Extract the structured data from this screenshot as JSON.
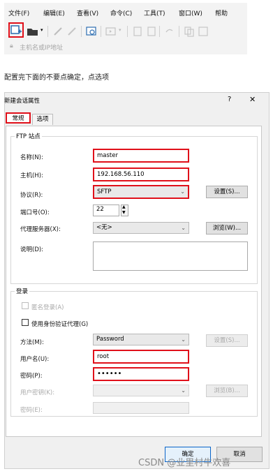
{
  "menu": [
    "文件(F)",
    "编辑(E)",
    "查看(V)",
    "命令(C)",
    "工具(T)",
    "窗口(W)",
    "帮助"
  ],
  "toolbar": {
    "icons": [
      "new-session-icon",
      "open-folder-icon",
      "dropdown-icon",
      "connect-icon",
      "disconnect-icon",
      "terminal-icon",
      "transfer-icon",
      "copy-icon",
      "paste-icon",
      "find-icon",
      "clone-icon",
      "tile-icon"
    ]
  },
  "address_placeholder": "主机名或IP地址",
  "caption": "配置完下面的不要点确定，点选项",
  "dialog": {
    "title": "新建会话属性",
    "help": "?",
    "close": "✕",
    "tabs": [
      "常规",
      "选项"
    ],
    "ftp_group": "FTP 站点",
    "name_label": "名称(N):",
    "name_value": "master",
    "host_label": "主机(H):",
    "host_value": "192.168.56.110",
    "protocol_label": "协议(R):",
    "protocol_value": "SFTP",
    "settings_button": "设置(S)...",
    "port_label": "端口号(O):",
    "port_value": "22",
    "proxy_label": "代理服务器(X):",
    "proxy_value": "<无>",
    "browse_button": "浏览(W)...",
    "desc_label": "说明(D):",
    "login_group": "登录",
    "anon_label": "匿名登录(A)",
    "agent_label": "使用身份验证代理(G)",
    "method_label": "方法(M):",
    "method_value": "Password",
    "method_settings_button": "设置(S)...",
    "user_label": "用户名(U):",
    "user_value": "root",
    "pass_label": "密码(P):",
    "pass_value": "••••••",
    "key_label": "用户密钥(K):",
    "key_browse_button": "浏览(B)...",
    "phrase_label": "密码(E):",
    "ok_button": "确定",
    "cancel_button": "取消"
  },
  "watermark": "CSDN @业里村牛欢喜"
}
